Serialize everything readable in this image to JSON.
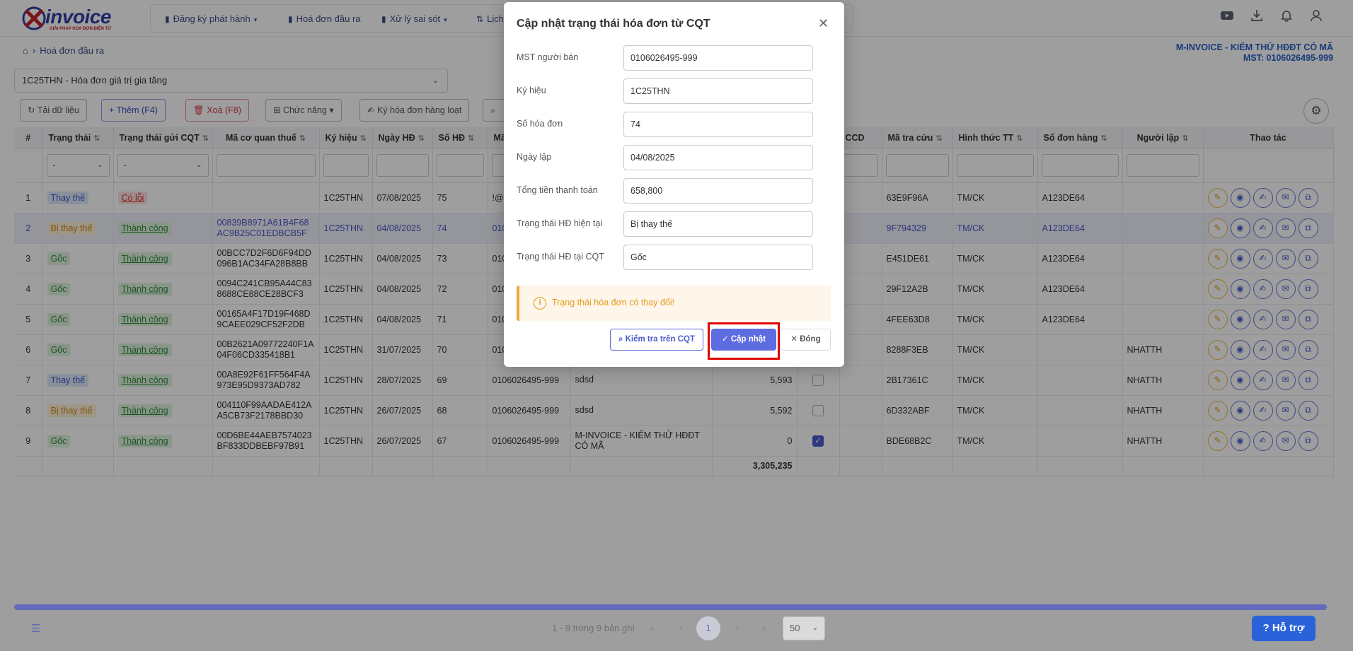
{
  "logo": {
    "text": "invoice",
    "tagline": "GIẢI PHÁP HÓA ĐƠN ĐIỆN TỬ"
  },
  "nav": [
    {
      "label": "Đăng ký phát hành",
      "icon": "document-icon",
      "has_dropdown": true
    },
    {
      "label": "Hoá đơn đầu ra",
      "icon": "document-icon",
      "has_dropdown": false
    },
    {
      "label": "Xử lý sai sót",
      "icon": "document-icon",
      "has_dropdown": true
    },
    {
      "label": "Lịch",
      "icon": "sort-icon",
      "has_dropdown": false
    }
  ],
  "top_icons": [
    "youtube-icon",
    "download-icon",
    "bell-icon",
    "user-icon"
  ],
  "breadcrumb": {
    "current": "Hoá đơn đầu ra"
  },
  "company": {
    "name": "M-INVOICE - KIỂM THỬ HĐĐT CÓ MÃ",
    "tax_code": "MST: 0106026495-999"
  },
  "series_select": {
    "value": "1C25THN - Hóa đơn giá trị gia tăng"
  },
  "toolbar": {
    "reload": "Tải dữ liệu",
    "add": "Thêm (F4)",
    "delete": "Xoá (F8)",
    "functions": "Chức năng",
    "bulk_sign": "Ký hóa đơn hàng loạt"
  },
  "table": {
    "headers": {
      "idx": "#",
      "status": "Trạng thái",
      "cqt_status": "Trạng thái gửi CQT",
      "tax_code": "Mã cơ quan thuế",
      "symbol": "Ký hiệu",
      "date": "Ngày HĐ",
      "number": "Số HĐ",
      "ma": "Mã",
      "ccd": "CCD",
      "lookup": "Mã tra cứu",
      "payment": "Hình thức TT",
      "order": "Số đơn hàng",
      "creator": "Người lập",
      "actions": "Thao tác"
    },
    "filter_placeholder": "-",
    "rows": [
      {
        "idx": "1",
        "status": "Thay thế",
        "status_type": "replace",
        "cqt": "Có lỗi",
        "cqt_type": "err",
        "tax_code": "",
        "symbol": "1C25THN",
        "date": "07/08/2025",
        "number": "75",
        "mst": "!@",
        "buyer": "",
        "amount": "",
        "checked": false,
        "show_chk": false,
        "lookup": "63E9F96A",
        "payment": "TM/CK",
        "order": "A123DE64",
        "creator": ""
      },
      {
        "idx": "2",
        "status": "Bị thay thế",
        "status_type": "replaced",
        "cqt": "Thành công",
        "cqt_type": "ok",
        "tax_code": "00839B8971A61B4F68AC9B25C01EDBCB5F",
        "symbol": "1C25THN",
        "date": "04/08/2025",
        "number": "74",
        "mst": "0106",
        "buyer": "",
        "amount": "",
        "checked": false,
        "show_chk": false,
        "lookup": "9F794329",
        "payment": "TM/CK",
        "order": "A123DE64",
        "creator": "",
        "selected": true
      },
      {
        "idx": "3",
        "status": "Gốc",
        "status_type": "orig",
        "cqt": "Thành công",
        "cqt_type": "ok",
        "tax_code": "00BCC7D2F6D6F94DD096B1AC34FA28B8BB",
        "symbol": "1C25THN",
        "date": "04/08/2025",
        "number": "73",
        "mst": "0106",
        "buyer": "",
        "amount": "",
        "checked": false,
        "show_chk": false,
        "lookup": "E451DE61",
        "payment": "TM/CK",
        "order": "A123DE64",
        "creator": ""
      },
      {
        "idx": "4",
        "status": "Gốc",
        "status_type": "orig",
        "cqt": "Thành công",
        "cqt_type": "ok",
        "tax_code": "0094C241CB95A44C838688CE88CE28BCF3",
        "symbol": "1C25THN",
        "date": "04/08/2025",
        "number": "72",
        "mst": "0106",
        "buyer": "",
        "amount": "",
        "checked": false,
        "show_chk": false,
        "lookup": "29F12A2B",
        "payment": "TM/CK",
        "order": "A123DE64",
        "creator": ""
      },
      {
        "idx": "5",
        "status": "Gốc",
        "status_type": "orig",
        "cqt": "Thành công",
        "cqt_type": "ok",
        "tax_code": "00165A4F17D19F468D9CAEE029CF52F2DB",
        "symbol": "1C25THN",
        "date": "04/08/2025",
        "number": "71",
        "mst": "0106",
        "buyer": "",
        "amount": "",
        "checked": false,
        "show_chk": false,
        "lookup": "4FEE63D8",
        "payment": "TM/CK",
        "order": "A123DE64",
        "creator": ""
      },
      {
        "idx": "6",
        "status": "Gốc",
        "status_type": "orig",
        "cqt": "Thành công",
        "cqt_type": "ok",
        "tax_code": "00B2621A09772240F1A04F06CD335418B1",
        "symbol": "1C25THN",
        "date": "31/07/2025",
        "number": "70",
        "mst": "0106",
        "buyer": "",
        "amount": "",
        "checked": false,
        "show_chk": false,
        "lookup": "8288F3EB",
        "payment": "TM/CK",
        "order": "",
        "creator": "NHATTH"
      },
      {
        "idx": "7",
        "status": "Thay thế",
        "status_type": "replace",
        "cqt": "Thành công",
        "cqt_type": "ok",
        "tax_code": "00A8E92F61FF564F4A973E95D9373AD782",
        "symbol": "1C25THN",
        "date": "28/07/2025",
        "number": "69",
        "mst": "0106026495-999",
        "buyer": "sdsd",
        "amount": "5,593",
        "checked": false,
        "show_chk": true,
        "lookup": "2B17361C",
        "payment": "TM/CK",
        "order": "",
        "creator": "NHATTH"
      },
      {
        "idx": "8",
        "status": "Bị thay thế",
        "status_type": "replaced",
        "cqt": "Thành công",
        "cqt_type": "ok",
        "tax_code": "004110F99AADAE412AA5CB73F2178BBD30",
        "symbol": "1C25THN",
        "date": "26/07/2025",
        "number": "68",
        "mst": "0106026495-999",
        "buyer": "sdsd",
        "amount": "5,592",
        "checked": false,
        "show_chk": true,
        "lookup": "6D332ABF",
        "payment": "TM/CK",
        "order": "",
        "creator": "NHATTH"
      },
      {
        "idx": "9",
        "status": "Gốc",
        "status_type": "orig",
        "cqt": "Thành công",
        "cqt_type": "ok",
        "tax_code": "00D6BE44AEB7574023BF833DDBEBF97B91",
        "symbol": "1C25THN",
        "date": "26/07/2025",
        "number": "67",
        "mst": "0106026495-999",
        "buyer": "M-INVOICE - KIỂM THỬ HĐĐT CÓ MÃ",
        "amount": "0",
        "checked": true,
        "show_chk": true,
        "lookup": "BDE68B2C",
        "payment": "TM/CK",
        "order": "",
        "creator": "NHATTH"
      }
    ],
    "total": "3,305,235"
  },
  "pager": {
    "info": "1 - 9 trong 9 bản ghi",
    "current": "1",
    "page_size": "50"
  },
  "help": "Hỗ trợ",
  "modal": {
    "title": "Cập nhật trạng thái hóa đơn từ CQT",
    "fields": [
      {
        "label": "MST người bán",
        "value": "0106026495-999"
      },
      {
        "label": "Ký hiệu",
        "value": "1C25THN"
      },
      {
        "label": "Số hóa đơn",
        "value": "74"
      },
      {
        "label": "Ngày lập",
        "value": "04/08/2025"
      },
      {
        "label": "Tổng tiền thanh toán",
        "value": "658,800"
      },
      {
        "label": "Trạng thái HĐ hiện tại",
        "value": "Bị thay thế"
      },
      {
        "label": "Trạng thái HĐ tại CQT",
        "value": "Gốc"
      }
    ],
    "warning": "Trạng thái hóa đơn có thay đổi!",
    "btn_check": "Kiểm tra trên CQT",
    "btn_update": "Cập nhật",
    "btn_close": "Đóng"
  },
  "colors": {
    "primary": "#5d6ce0",
    "accent_blue": "#2860c8",
    "warning": "#e39a1a",
    "highlight": "#e00000"
  }
}
